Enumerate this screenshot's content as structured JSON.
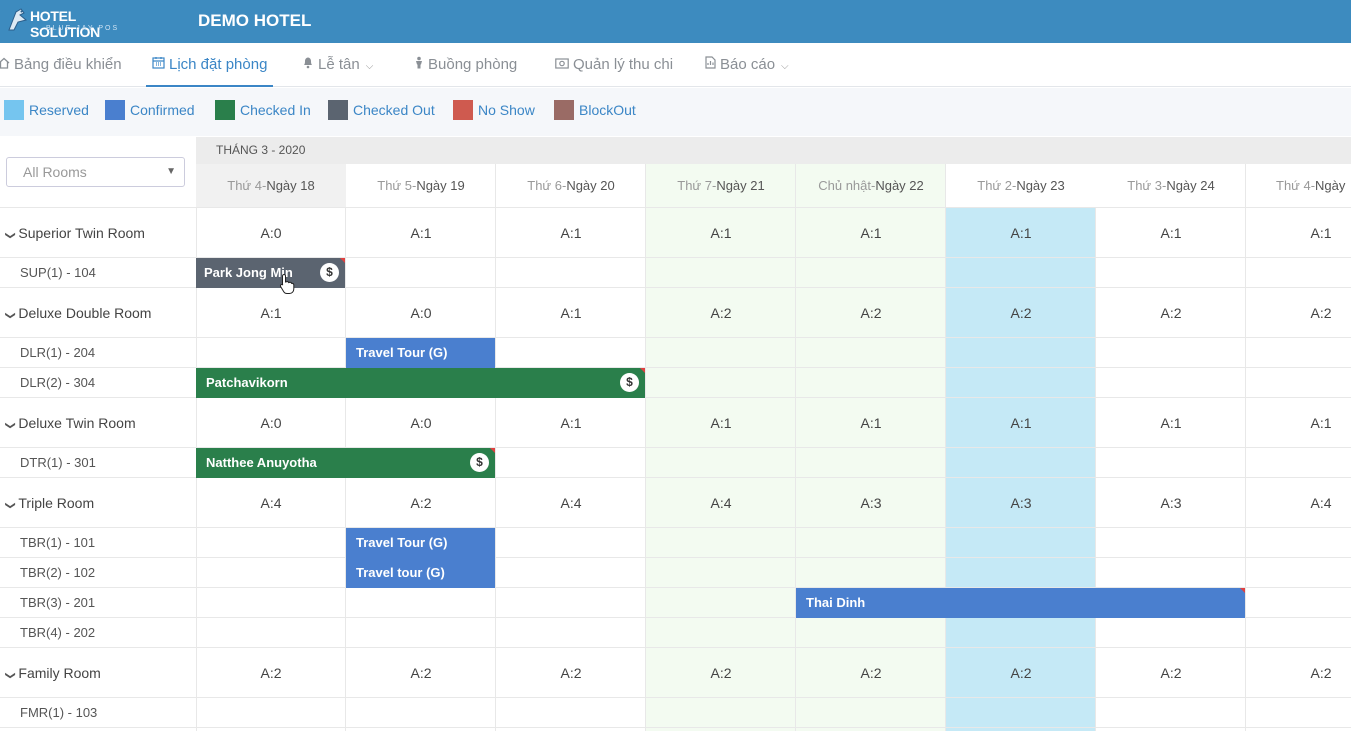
{
  "header": {
    "logo_line1": "HOTEL SOLUTION",
    "logo_line2": "BLUE JAY POS",
    "hotel_name": "DEMO HOTEL"
  },
  "nav": {
    "tabs": [
      {
        "label": "Bảng điều khiển",
        "icon": "home-icon",
        "active": false
      },
      {
        "label": "Lịch đặt phòng",
        "icon": "calendar-icon",
        "active": true
      },
      {
        "label": "Lễ tân",
        "icon": "bell-icon",
        "active": false,
        "dropdown": true
      },
      {
        "label": "Buồng phòng",
        "icon": "person-icon",
        "active": false
      },
      {
        "label": "Quản lý thu chi",
        "icon": "money-icon",
        "active": false
      },
      {
        "label": "Báo cáo",
        "icon": "report-icon",
        "active": false,
        "dropdown": true
      }
    ]
  },
  "legend": [
    {
      "label": "Reserved",
      "color": "#75c5ef"
    },
    {
      "label": "Confirmed",
      "color": "#4a7fcf"
    },
    {
      "label": "Checked In",
      "color": "#2a7f4b"
    },
    {
      "label": "Checked Out",
      "color": "#5b6470"
    },
    {
      "label": "No Show",
      "color": "#cf5a4f"
    },
    {
      "label": "BlockOut",
      "color": "#9a6b65"
    }
  ],
  "room_filter": {
    "value": "All Rooms"
  },
  "month": "THÁNG 3 - 2020",
  "days": [
    {
      "weekday": "Thứ 4-",
      "day": "Ngày 18"
    },
    {
      "weekday": "Thứ 5-",
      "day": "Ngày 19"
    },
    {
      "weekday": "Thứ 6-",
      "day": "Ngày 20"
    },
    {
      "weekday": "Thứ 7-",
      "day": "Ngày 21"
    },
    {
      "weekday": "Chủ nhật-",
      "day": "Ngày 22"
    },
    {
      "weekday": "Thứ 2-",
      "day": "Ngày 23"
    },
    {
      "weekday": "Thứ 3-",
      "day": "Ngày 24"
    },
    {
      "weekday": "Thứ 4-",
      "day": "Ngày"
    }
  ],
  "room_types": [
    {
      "name": "Superior Twin Room",
      "availability": [
        "A:0",
        "A:1",
        "A:1",
        "A:1",
        "A:1",
        "A:1",
        "A:1",
        "A:1"
      ],
      "rooms": [
        "SUP(1) - 104"
      ]
    },
    {
      "name": "Deluxe Double Room",
      "availability": [
        "A:1",
        "A:0",
        "A:1",
        "A:2",
        "A:2",
        "A:2",
        "A:2",
        "A:2"
      ],
      "rooms": [
        "DLR(1) - 204",
        "DLR(2) - 304"
      ]
    },
    {
      "name": "Deluxe Twin Room",
      "availability": [
        "A:0",
        "A:0",
        "A:1",
        "A:1",
        "A:1",
        "A:1",
        "A:1",
        "A:1"
      ],
      "rooms": [
        "DTR(1) - 301"
      ]
    },
    {
      "name": "Triple Room",
      "availability": [
        "A:4",
        "A:2",
        "A:4",
        "A:4",
        "A:3",
        "A:3",
        "A:3",
        "A:4"
      ],
      "rooms": [
        "TBR(1) - 101",
        "TBR(2) - 102",
        "TBR(3) - 201",
        "TBR(4) - 202"
      ]
    },
    {
      "name": "Family Room",
      "availability": [
        "A:2",
        "A:2",
        "A:2",
        "A:2",
        "A:2",
        "A:2",
        "A:2",
        "A:2"
      ],
      "rooms": [
        "FMR(1) - 103"
      ]
    }
  ],
  "bookings": [
    {
      "guest": "Park Jong Min",
      "room": "SUP(1) - 104",
      "status": "Checked Out",
      "color": "#5b6470",
      "payment_icon": true
    },
    {
      "guest": "Travel Tour (G)",
      "room": "DLR(1) - 204",
      "status": "Confirmed",
      "color": "#4a7fcf",
      "payment_icon": false
    },
    {
      "guest": "Patchavikorn",
      "room": "DLR(2) - 304",
      "status": "Checked In",
      "color": "#2a7f4b",
      "payment_icon": true
    },
    {
      "guest": "Natthee Anuyotha",
      "room": "DTR(1) - 301",
      "status": "Checked In",
      "color": "#2a7f4b",
      "payment_icon": true
    },
    {
      "guest": "Travel Tour (G)",
      "room": "TBR(1) - 101",
      "status": "Confirmed",
      "color": "#4a7fcf",
      "payment_icon": false
    },
    {
      "guest": "Travel tour (G)",
      "room": "TBR(2) - 102",
      "status": "Confirmed",
      "color": "#4a7fcf",
      "payment_icon": false
    },
    {
      "guest": "Thai Dinh",
      "room": "TBR(3) - 201",
      "status": "Confirmed",
      "color": "#4a7fcf",
      "payment_icon": false
    }
  ]
}
